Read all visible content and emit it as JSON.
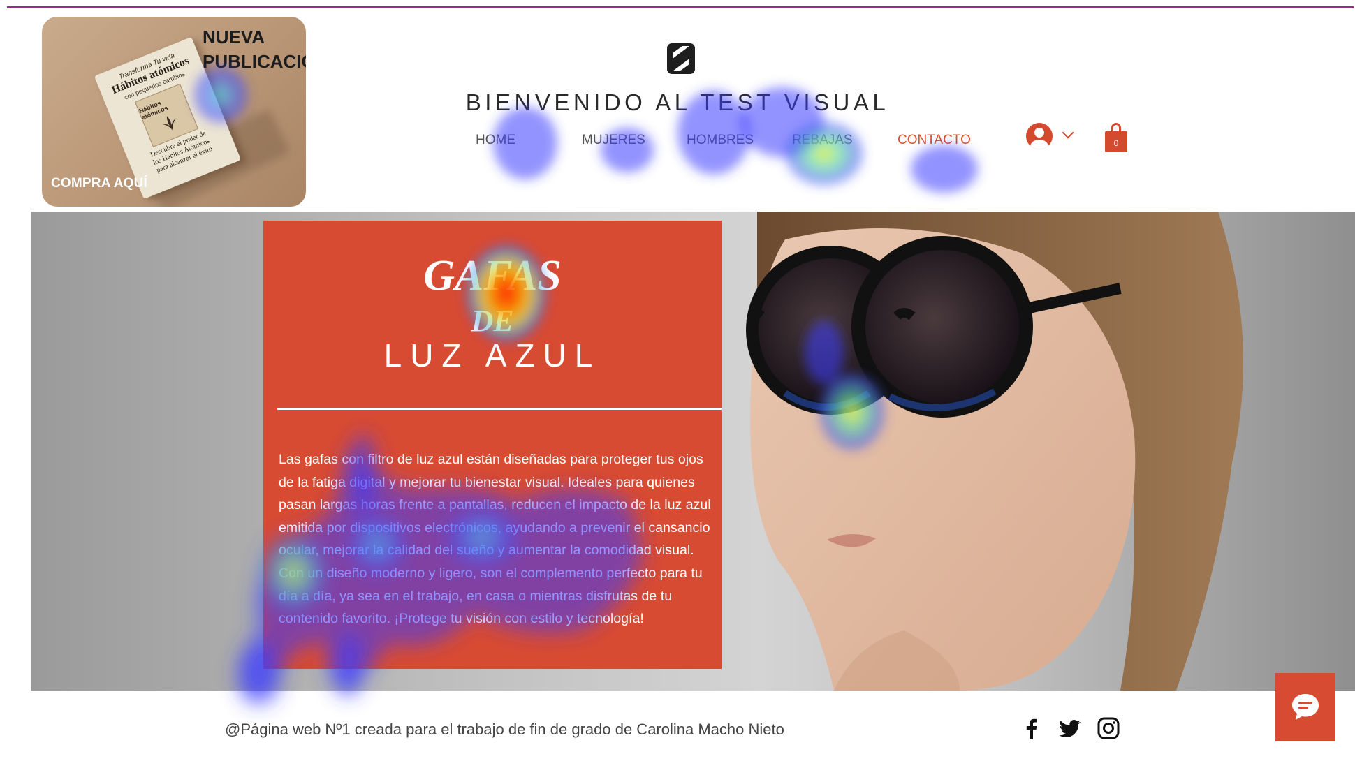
{
  "promo": {
    "heading_line1": "NUEVA",
    "heading_line2": "PUBLICACIÓN",
    "cta": "COMPRA AQUÍ",
    "book": {
      "subtitle_top": "Transforma Tu vida",
      "title": "Hábitos atómicos",
      "subtitle": "con pequeños cambios",
      "cover_title": "Hábitos atómicos",
      "bottom_line1": "Descubre el poder de",
      "bottom_line2": "los Hábitos Atómicos",
      "bottom_line3": "para alcanzar el éxito"
    }
  },
  "header": {
    "site_title": "BIENVENIDO AL TEST VISUAL",
    "nav": [
      "HOME",
      "MUJERES",
      "HOMBRES",
      "REBAJAS",
      "CONTACTO"
    ],
    "cart_count": "0",
    "accent_color": "#d84b33"
  },
  "hero": {
    "title_line1": "GAFAS",
    "title_line2": "DE",
    "title_line3": "LUZ AZUL",
    "body": "Las gafas con filtro de luz azul están diseñadas para proteger tus ojos de la fatiga digital y mejorar tu bienestar visual. Ideales para quienes pasan largas horas frente a pantallas, reducen el impacto de la luz azul emitida por dispositivos electrónicos, ayudando a prevenir el cansancio ocular, mejorar la calidad del sueño y aumentar la comodidad visual. Con un diseño moderno y ligero, son el complemento perfecto para tu día a día, ya sea en el trabajo, en casa o mientras disfrutas de tu contenido favorito. ¡Protege tu visión con estilo y tecnología!"
  },
  "footer": {
    "credit": "@Página web Nº1 creada para el trabajo de fin de grado de Carolina Macho Nieto",
    "social_icons": [
      "facebook-icon",
      "twitter-icon",
      "instagram-icon"
    ]
  },
  "chat": {
    "icon": "chat-bubble-icon"
  }
}
